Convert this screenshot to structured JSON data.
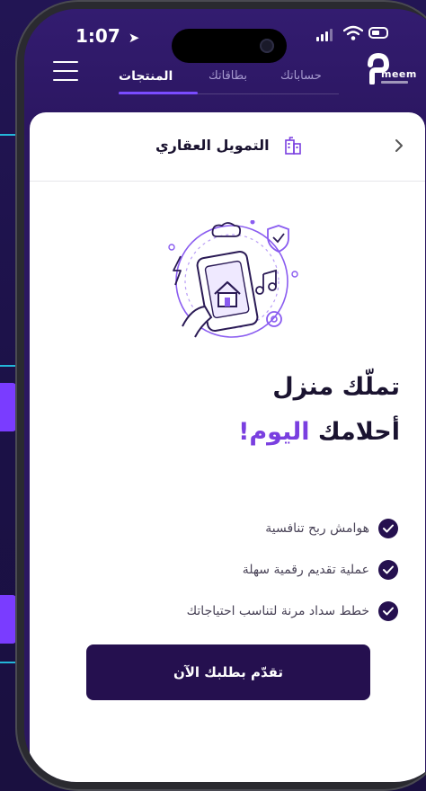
{
  "status_bar": {
    "time": "1:07",
    "location_arrow": "➤"
  },
  "header": {
    "tabs": [
      {
        "label": "المنتجات",
        "active": true
      },
      {
        "label": "بطاقاتك",
        "active": false
      },
      {
        "label": "حساباتك",
        "active": false
      }
    ],
    "logo": {
      "word": "meem"
    }
  },
  "page": {
    "title": "التمويل العقاري",
    "back_icon": "chevron-right-icon",
    "title_icon": "building-icon"
  },
  "hero": {
    "line1": "تملّك منزل",
    "line2_prefix": "أحلامك ",
    "line2_accent": "اليوم!"
  },
  "features": [
    {
      "text": "هوامش ربح تنافسية"
    },
    {
      "text": "عملية تقديم رقمية سهلة"
    },
    {
      "text": "خطط سداد مرنة لتناسب احتياجاتك"
    }
  ],
  "cta": {
    "label": "تقدّم بطلبك الآن"
  },
  "colors": {
    "primary": "#25104f",
    "accent": "#7a3fe0",
    "header_bg": "#2b1760"
  }
}
